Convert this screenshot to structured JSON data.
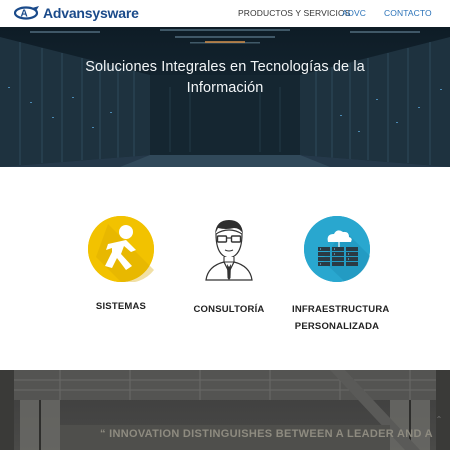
{
  "header": {
    "brand": "Advansysware",
    "nav": [
      {
        "label": "PRODUCTOS Y SERVICIOS",
        "active": false
      },
      {
        "label": "ADVC",
        "active": true
      },
      {
        "label": "CONTACTO",
        "active": true
      }
    ]
  },
  "hero": {
    "title": "Soluciones Integrales en Tecnologías de la Información"
  },
  "services": [
    {
      "label": "SISTEMAS",
      "icon": "running-person-icon",
      "color": "#f2c200"
    },
    {
      "label": "CONSULTORÍA",
      "icon": "consultant-avatar-icon",
      "color": "#ffffff"
    },
    {
      "label": "INFRAESTRUCTURA PERSONALIZADA",
      "icon": "cloud-server-icon",
      "color": "#29a7cf"
    }
  ],
  "bottom": {
    "quote": "“ INNOVATION DISTINGUISHES BETWEEN A LEADER AND A"
  },
  "colors": {
    "brand": "#1a4a8a",
    "nav_active": "#2a72b8",
    "sistemas": "#f2c200",
    "infra": "#29a7cf"
  }
}
